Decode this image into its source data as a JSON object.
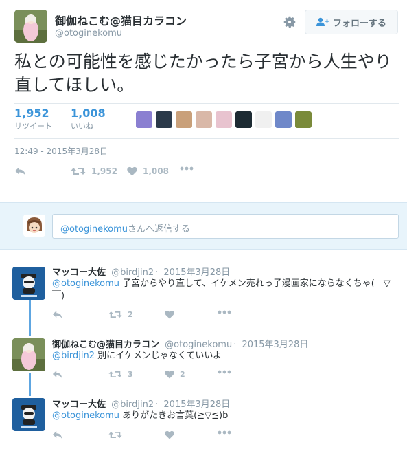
{
  "main_tweet": {
    "display_name": "御伽ねこむ@猫目カラコン",
    "handle": "@otoginekomu",
    "follow_label": "フォローする",
    "text": "私との可能性を感じたかったら子宮から人生やり直してほしい。",
    "retweets_count": "1,952",
    "retweets_label": "リツイート",
    "likes_count": "1,008",
    "likes_label": "いいね",
    "timestamp": "12:49 - 2015年3月28日",
    "action_retweet_count": "1,952",
    "action_like_count": "1,008"
  },
  "liker_avatar_colors": [
    "#8a7fd1",
    "#2b3a4a",
    "#c9a07a",
    "#d9b8a8",
    "#e8c3cf",
    "#1d2b33",
    "#f0f0f0",
    "#6f88c9",
    "#7a8a3a"
  ],
  "reply_box": {
    "mention": "@otoginekomu",
    "placeholder_rest": "さんへ返信する"
  },
  "conversation": [
    {
      "display_name": "マッコー大佐",
      "handle": "@birdjin2",
      "date": "2015年3月28日",
      "mention": "@otoginekomu",
      "text": " 子宮からやり直して、イケメン売れっ子漫画家にならなくちゃ(￣▽￣)",
      "retweet_count": "2",
      "like_count": ""
    },
    {
      "display_name": "御伽ねこむ@猫目カラコン",
      "handle": "@otoginekomu",
      "date": "2015年3月28日",
      "mention": "@birdjin2",
      "text": " 別にイケメンじゃなくていいよ",
      "retweet_count": "3",
      "like_count": "2"
    },
    {
      "display_name": "マッコー大佐",
      "handle": "@birdjin2",
      "date": "2015年3月28日",
      "mention": "@otoginekomu",
      "text": " ありがたきお言葉(≧▽≦)b",
      "retweet_count": "",
      "like_count": ""
    }
  ],
  "colors": {
    "accent": "#3b94d9",
    "muted": "#8899a6",
    "icon": "#aab8c2",
    "reply_bg": "#e8f4fb"
  }
}
